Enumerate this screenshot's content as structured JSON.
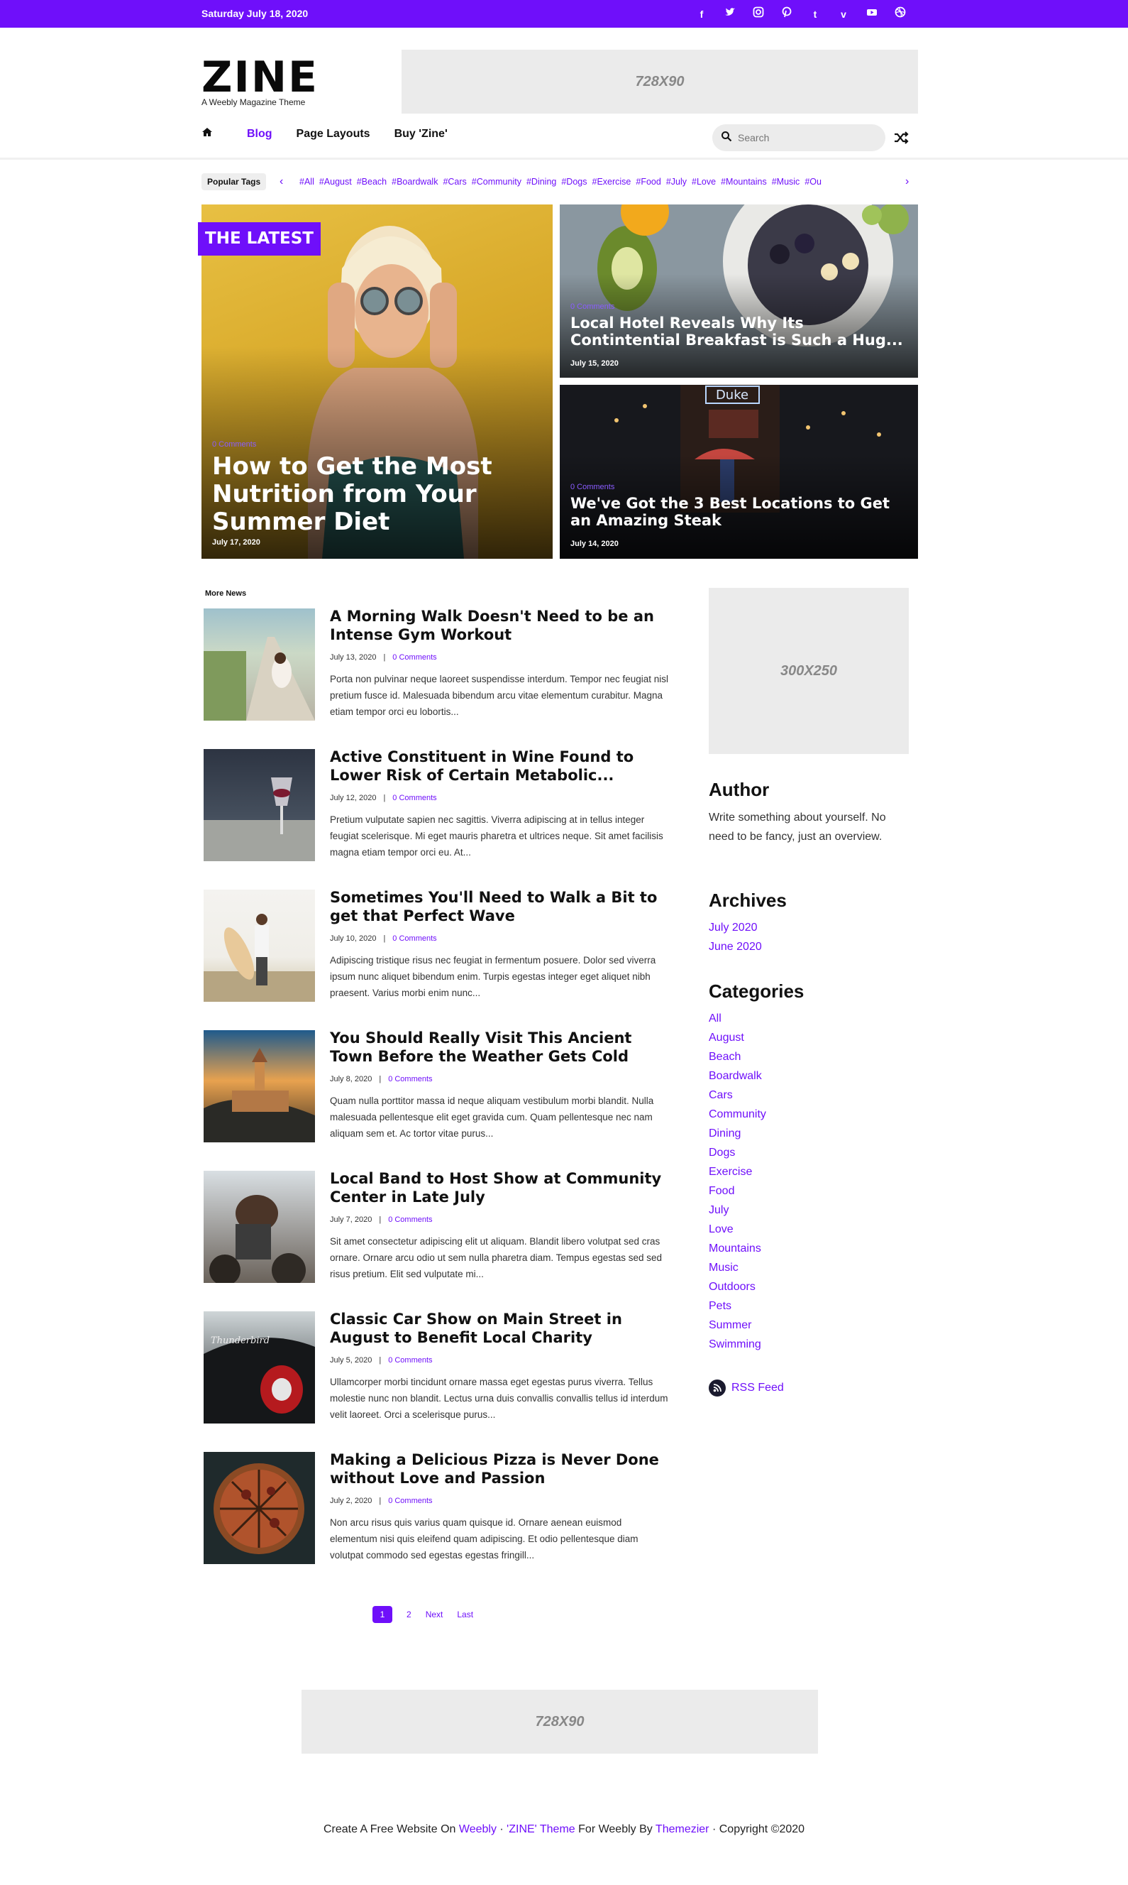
{
  "topbar": {
    "date": "Saturday July 18, 2020",
    "social_icons": [
      "facebook-icon",
      "twitter-icon",
      "instagram-icon",
      "pinterest-icon",
      "tumblr-icon",
      "vimeo-icon",
      "youtube-icon",
      "dribbble-icon"
    ],
    "accent_color": "#6f0ffa"
  },
  "brand": {
    "logo": "ZINE",
    "tagline": "A Weebly Magazine Theme"
  },
  "ads": {
    "top": "728X90",
    "side": "300X250",
    "bottom": "728X90"
  },
  "nav": {
    "home_icon": "home-icon",
    "items": [
      {
        "label": "Blog",
        "active": true
      },
      {
        "label": "Page Layouts",
        "active": false
      },
      {
        "label": "Buy 'Zine'",
        "active": false
      }
    ],
    "search_placeholder": "Search",
    "shuffle_icon": "shuffle-icon"
  },
  "tags": {
    "label": "Popular Tags",
    "items": [
      "#All",
      "#August",
      "#Beach",
      "#Boardwalk",
      "#Cars",
      "#Community",
      "#Dining",
      "#Dogs",
      "#Exercise",
      "#Food",
      "#July",
      "#Love",
      "#Mountains",
      "#Music",
      "#Ou"
    ]
  },
  "hero": {
    "badge": "THE LATEST",
    "main": {
      "comments": "0 Comments",
      "title": "How to Get the Most Nutrition from Your Summer Diet",
      "date": "July 17, 2020"
    },
    "side": [
      {
        "comments": "0 Comments",
        "title": "Local Hotel Reveals Why Its Contintential Breakfast is Such a Hug...",
        "date": "July 15, 2020"
      },
      {
        "comments": "0 Comments",
        "title": "We've Got the 3 Best Locations to Get an Amazing Steak",
        "date": "July 14, 2020"
      }
    ]
  },
  "more_news": {
    "label": "More News",
    "posts": [
      {
        "title": "A Morning Walk Doesn't Need to be an Intense Gym Workout",
        "date": "July 13, 2020",
        "comments": "0 Comments",
        "excerpt": "Porta non pulvinar neque laoreet suspendisse interdum. Tempor nec feugiat nisl pretium fusce id. Malesuada bibendum arcu vitae elementum curabitur. Magna etiam tempor orci eu lobortis..."
      },
      {
        "title": "Active Constituent in Wine Found to Lower Risk of Certain Metabolic...",
        "date": "July 12, 2020",
        "comments": "0 Comments",
        "excerpt": "Pretium vulputate sapien nec sagittis. Viverra adipiscing at in tellus integer feugiat scelerisque. Mi eget mauris pharetra et ultrices neque. Sit amet facilisis magna etiam tempor orci eu. At..."
      },
      {
        "title": "Sometimes You'll Need to Walk a Bit to get that Perfect Wave",
        "date": "July 10, 2020",
        "comments": "0 Comments",
        "excerpt": "Adipiscing tristique risus nec feugiat in fermentum posuere. Dolor sed viverra ipsum nunc aliquet bibendum enim. Turpis egestas integer eget aliquet nibh praesent. Varius morbi enim nunc..."
      },
      {
        "title": "You Should Really Visit This Ancient Town Before the Weather Gets Cold",
        "date": "July 8, 2020",
        "comments": "0 Comments",
        "excerpt": "Quam nulla porttitor massa id neque aliquam vestibulum morbi blandit. Nulla malesuada pellentesque elit eget gravida cum. Quam pellentesque nec nam aliquam sem et. Ac tortor vitae purus..."
      },
      {
        "title": "Local Band to Host Show at Community Center in Late July",
        "date": "July 7, 2020",
        "comments": "0 Comments",
        "excerpt": "Sit amet consectetur adipiscing elit ut aliquam. Blandit libero volutpat sed cras ornare. Ornare arcu odio ut sem nulla pharetra diam. Tempus egestas sed sed risus pretium. Elit sed vulputate mi..."
      },
      {
        "title": "Classic Car Show on Main Street in August to Benefit Local Charity",
        "date": "July 5, 2020",
        "comments": "0 Comments",
        "excerpt": "Ullamcorper morbi tincidunt ornare massa eget egestas purus viverra. Tellus molestie nunc non blandit. Lectus urna duis convallis convallis tellus id interdum velit laoreet. Orci a scelerisque purus..."
      },
      {
        "title": "Making a Delicious Pizza is Never Done without Love and Passion",
        "date": "July 2, 2020",
        "comments": "0 Comments",
        "excerpt": "Non arcu risus quis varius quam quisque id. Ornare aenean euismod elementum nisi quis eleifend quam adipiscing. Et odio pellentesque diam volutpat commodo sed egestas egestas fringill..."
      }
    ]
  },
  "sidebar": {
    "author_title": "Author",
    "author_text": "Write something about yourself. No need to be fancy, just an overview.",
    "archives_title": "Archives",
    "archives": [
      "July 2020",
      "June 2020"
    ],
    "categories_title": "Categories",
    "categories": [
      "All",
      "August",
      "Beach",
      "Boardwalk",
      "Cars",
      "Community",
      "Dining",
      "Dogs",
      "Exercise",
      "Food",
      "July",
      "Love",
      "Mountains",
      "Music",
      "Outdoors",
      "Pets",
      "Summer",
      "Swimming"
    ],
    "rss_label": "RSS Feed"
  },
  "pagination": {
    "current": "1",
    "page2": "2",
    "next": "Next",
    "last": "Last"
  },
  "footer": {
    "t1": "Create A Free Website On",
    "weebly": "Weebly",
    "dot": "·",
    "theme": "'ZINE' Theme",
    "t2": "For Weebly By",
    "themezier": "Themezier",
    "copyright": "Copyright ©2020"
  }
}
